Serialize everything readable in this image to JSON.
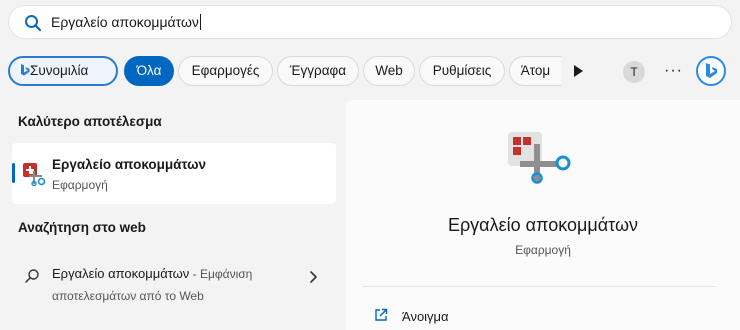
{
  "search": {
    "value": "Εργαλείο αποκομμάτων"
  },
  "filters": {
    "chat_label": "Συνομιλία",
    "tabs": [
      "Όλα",
      "Εφαρμογές",
      "Έγγραφα",
      "Web",
      "Ρυθμίσεις",
      "Άτομ"
    ],
    "avatar_initial": "T",
    "more": "···"
  },
  "best_match": {
    "heading": "Καλύτερο αποτέλεσμα",
    "title": "Εργαλείο αποκομμάτων",
    "subtitle": "Εφαρμογή"
  },
  "web_search": {
    "heading": "Αναζήτηση στο web",
    "query": "Εργαλείο αποκομμάτων",
    "suffix_line1": " - Εμφάνιση",
    "suffix_line2": "αποτελεσμάτων από το Web"
  },
  "preview": {
    "title": "Εργαλείο αποκομμάτων",
    "subtitle": "Εφαρμογή",
    "actions": [
      {
        "label": "Άνοιγμα",
        "icon": "open-external-icon"
      }
    ]
  },
  "colors": {
    "accent": "#0067c0",
    "bing": "#2b8ae6",
    "snip_red": "#c4302b"
  }
}
